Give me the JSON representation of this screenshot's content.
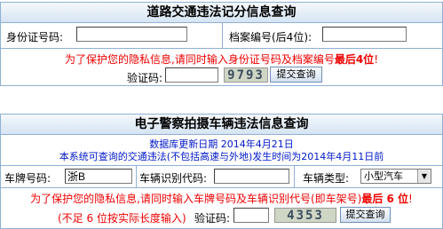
{
  "panel1": {
    "title": "道路交通违法记分信息查询",
    "id_label": "身份证号码:",
    "id_value": "",
    "file_label": "档案编号(后4位):",
    "file_value": "",
    "notice_prefix": "为了保护您的隐私信息,请同时输入身份证号码及档案编号",
    "notice_bold": "最后4位",
    "notice_suffix": "!",
    "captcha_label": "验证码:",
    "captcha_value": "",
    "captcha_text": "9793",
    "submit_label": "提交查询"
  },
  "panel2": {
    "title": "电子警察拍摄车辆违法信息查询",
    "update_text": "数据库更新日期 2014年4月21日",
    "range_text": "本系统可查询的交通违法(不包括高速与外地)发生时间为2014年4月11日前",
    "plate_label": "车牌号码:",
    "plate_value": "浙B",
    "vin_label": "车辆识别代码:",
    "vin_value": "",
    "type_label": "车辆类型:",
    "type_selected": "小型汽车",
    "notice_prefix": "为了保护您的隐私信息,请同时输入车牌号码及车辆识别代号(即车架号)",
    "notice_bold": "最后 6 位",
    "notice_suffix": "!",
    "short_note": "(不足 6 位按实际长度输入)",
    "captcha_label": "验证码:",
    "captcha_value": "",
    "captcha_text": "4353",
    "submit_label": "提交查询"
  },
  "colors": {
    "border": "#8fb0d6",
    "red": "#ee0000",
    "blue": "#0018c8"
  }
}
